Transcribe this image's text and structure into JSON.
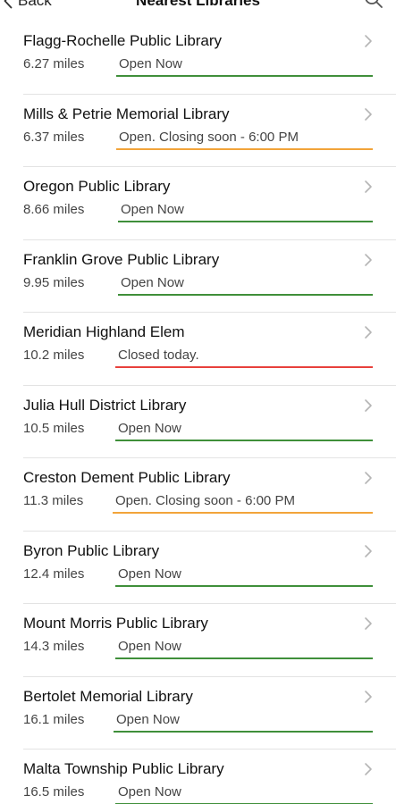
{
  "nav": {
    "back_label": "Back",
    "title": "Nearest Libraries",
    "search_icon": "search-icon"
  },
  "colors": {
    "open": "#3f8f3a",
    "closing_soon": "#f2a43a",
    "closed": "#e8413c"
  },
  "libraries": [
    {
      "name": "Flagg-Rochelle Public Library",
      "distance": "6.27 miles",
      "status": "Open Now",
      "status_type": "open"
    },
    {
      "name": "Mills & Petrie Memorial Library",
      "distance": "6.37 miles",
      "status": "Open. Closing soon - 6:00 PM",
      "status_type": "soon"
    },
    {
      "name": "Oregon Public Library",
      "distance": "8.66 miles",
      "status": "Open Now",
      "status_type": "open"
    },
    {
      "name": "Franklin Grove Public Library",
      "distance": "9.95 miles",
      "status": "Open Now",
      "status_type": "open"
    },
    {
      "name": "Meridian Highland Elem",
      "distance": "10.2 miles",
      "status": "Closed today.",
      "status_type": "closed"
    },
    {
      "name": "Julia Hull District Library",
      "distance": "10.5 miles",
      "status": "Open Now",
      "status_type": "open"
    },
    {
      "name": "Creston Dement Public Library",
      "distance": "11.3 miles",
      "status": "Open. Closing soon - 6:00 PM",
      "status_type": "soon"
    },
    {
      "name": "Byron Public Library",
      "distance": "12.4 miles",
      "status": "Open Now",
      "status_type": "open"
    },
    {
      "name": "Mount Morris Public Library",
      "distance": "14.3 miles",
      "status": "Open Now",
      "status_type": "open"
    },
    {
      "name": "Bertolet Memorial Library",
      "distance": "16.1 miles",
      "status": "Open Now",
      "status_type": "open"
    },
    {
      "name": "Malta Township Public Library",
      "distance": "16.5 miles",
      "status": "Open Now",
      "status_type": "open"
    }
  ]
}
